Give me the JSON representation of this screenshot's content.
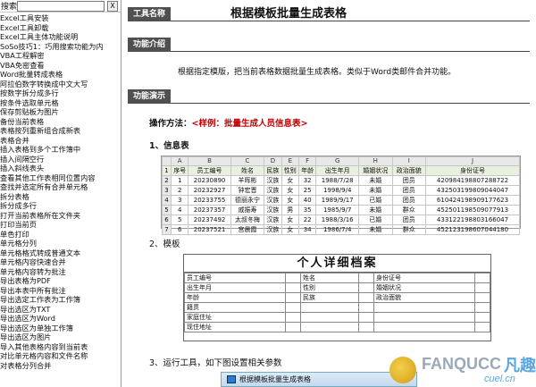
{
  "search": {
    "label": "搜索",
    "value": "",
    "button": "X"
  },
  "sidebar": {
    "items": [
      "Excel工具安装",
      "Excel工具卸载",
      "Excel工具主体功能说明",
      "SoSo技巧1：巧用搜索功能为内",
      "VBA工程解密",
      "VBA免密查看",
      "Word批量转成表格",
      "阿拉伯数字转换成中文大写",
      "按数字拆分成多行",
      "按条件选取单元格",
      "保存剪贴板为图片",
      "备份当前表格",
      "表格按列重新组合成新表",
      "表格合并",
      "插入表格到多个工作簿中",
      "插入间隔空行",
      "插入斜线表头",
      "查看其他工作表相同位置内容",
      "查找并选定所有合并单元格",
      "拆分表格",
      "拆分成多行",
      "打开当前表格所在文件夹",
      "打印当前页",
      "单色打印",
      "单元格分列",
      "单元格格式转成普通文本",
      "单元格内容快速合并",
      "单元格内容转为批注",
      "导出表格为PDF",
      "导出本表中所有批注",
      "导出选定工作表为工作簿",
      "导出选区为TXT",
      "导出选区为Word",
      "导出选区为单独工作簿",
      "导出选区为图片",
      "导入其他表格内容到当前表",
      "对比单元格内容和文件名称",
      "对表格分列合并"
    ]
  },
  "main": {
    "tool_name_label": "工具名称",
    "tool_title": "根据模板批量生成表格",
    "intro_label": "功能介绍",
    "intro_text": "根据指定模版，把当前表格数据批量生成表格。类似于Word类邮件合并功能。",
    "demo_label": "功能演示",
    "method_prefix": "操作方法：",
    "method_example": "<样例：批量生成人员信息表>",
    "step1": "1、信息表",
    "step2": "2、模板",
    "step3": "3、运行工具，如下图设置相关参数"
  },
  "sheet": {
    "col_letters": [
      "",
      "A",
      "B",
      "C",
      "D",
      "E",
      "F",
      "G",
      "H",
      "I",
      "J"
    ],
    "header": [
      "1",
      "序号",
      "员工编号",
      "姓名",
      "民族",
      "性别",
      "年龄",
      "出生年月",
      "婚姻状况",
      "政治面貌",
      "身份证号"
    ],
    "rows": [
      [
        "2",
        "1",
        "20230890",
        "羊晖彬",
        "汉族",
        "女",
        "32",
        "1988/7/28",
        "未婚",
        "团员",
        "420984198807288722"
      ],
      [
        "3",
        "2",
        "20232927",
        "钟宏晋",
        "汉族",
        "女",
        "25",
        "1998/9/4",
        "未婚",
        "团员",
        "432503199809044047"
      ],
      [
        "4",
        "3",
        "20233755",
        "德丽永宁",
        "汉族",
        "女",
        "40",
        "1989/9/17",
        "已婚",
        "团员",
        "610424198909177623"
      ],
      [
        "5",
        "4",
        "20237357",
        "戚振寿",
        "汉族",
        "男",
        "35",
        "1985/9/7",
        "未婚",
        "群众",
        "452501198509077913"
      ],
      [
        "6",
        "5",
        "20237492",
        "太叔冬梅",
        "汉族",
        "女",
        "22",
        "1988/3/16",
        "已婚",
        "团员",
        "433122198803166047"
      ],
      [
        "7",
        "6",
        "20237521",
        "宫晨霞",
        "汉族",
        "女",
        "34",
        "1986/7/4",
        "未婚",
        "群众",
        "452123198607044180"
      ]
    ]
  },
  "template": {
    "title": "个人详细档案",
    "rows": [
      [
        "员工编号",
        "",
        "姓名",
        "",
        "身份证号",
        ""
      ],
      [
        "出生年月",
        "",
        "性别",
        "",
        "婚姻状况",
        ""
      ],
      [
        "年龄",
        "",
        "民族",
        "",
        "政治面貌",
        ""
      ],
      [
        "籍贯",
        "",
        "",
        "",
        "",
        ""
      ],
      [
        "家庭住址",
        "",
        "",
        "",
        "",
        ""
      ],
      [
        "现住地址",
        "",
        "",
        "",
        "",
        ""
      ]
    ]
  },
  "dialog": {
    "title": "根据模板批量生成表格"
  },
  "watermark": {
    "brand": "FANQUCC",
    "cn": "凡趣",
    "domain": "cuel.cn"
  }
}
